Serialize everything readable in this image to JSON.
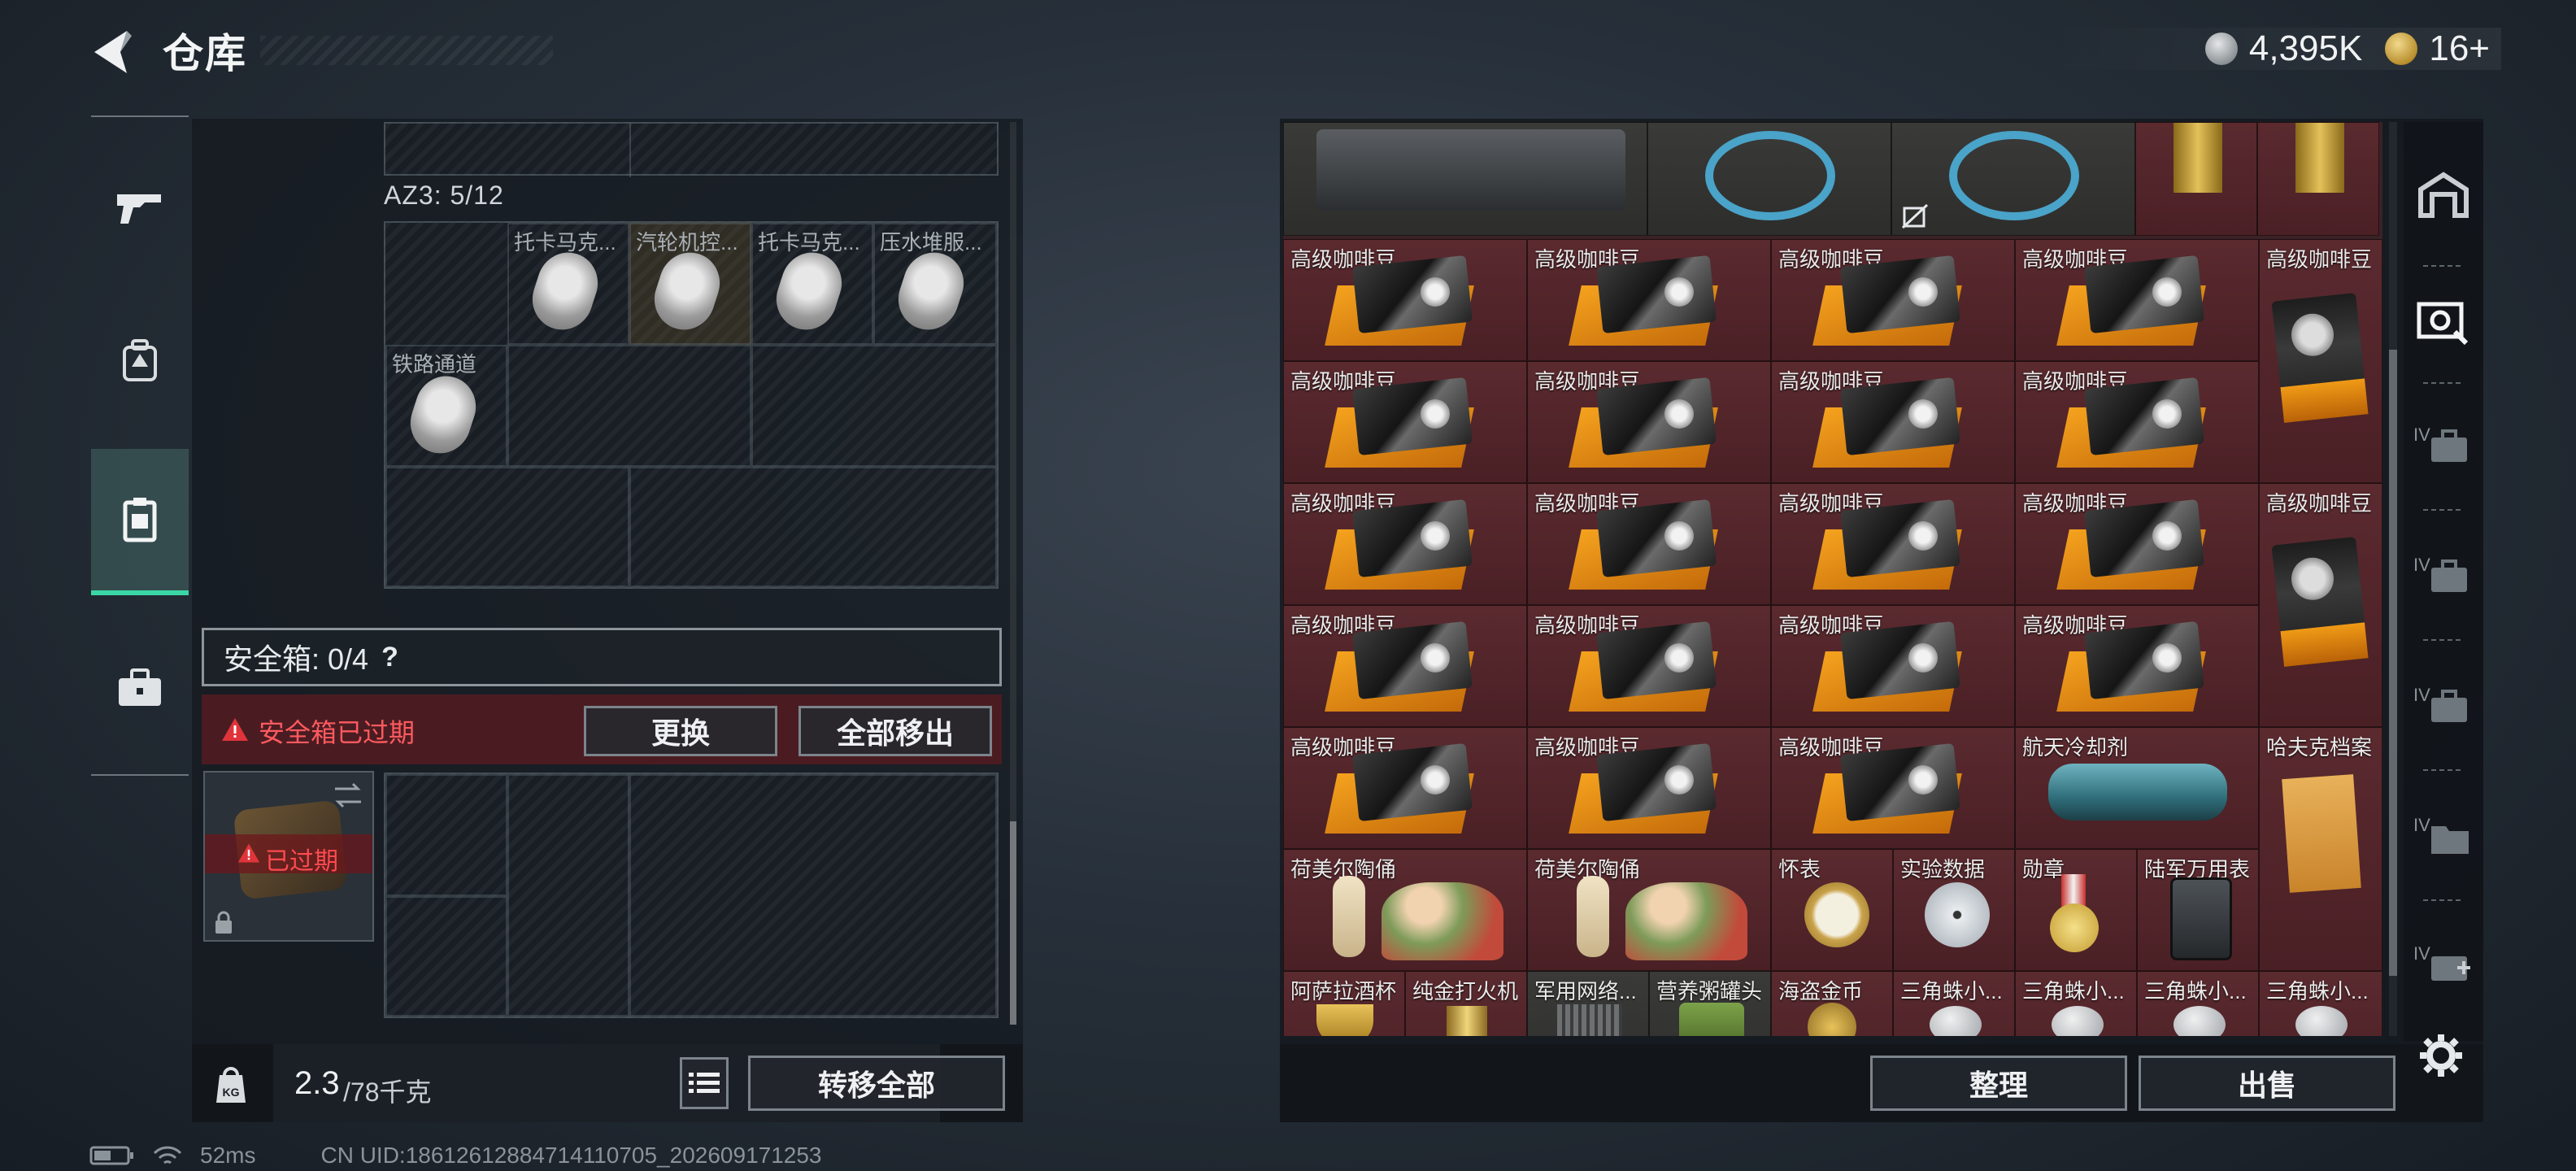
{
  "header": {
    "title": "仓库",
    "currency": [
      {
        "icon": "silver-coin-icon",
        "value": "4,395K"
      },
      {
        "icon": "gold-triangle-coin-icon",
        "value": "16+"
      }
    ]
  },
  "left_nav": {
    "items": [
      {
        "icon": "gun-icon",
        "active": false
      },
      {
        "icon": "backpack-icon",
        "active": false
      },
      {
        "icon": "container-icon",
        "active": true
      },
      {
        "icon": "briefcase-icon",
        "active": false
      }
    ]
  },
  "left_panel": {
    "az3_label": "AZ3: 5/12",
    "az3_items": [
      "托卡马克...",
      "汽轮机控...",
      "托卡马克...",
      "压水堆服...",
      "铁路通道"
    ],
    "safebox_label": "安全箱: 0/4",
    "safebox_help": "?",
    "expired_warning": "安全箱已过期",
    "replace_button": "更换",
    "move_all_out_button": "全部移出",
    "expired_badge": "已过期",
    "weight_value": "2.3",
    "weight_capacity": "/78千克",
    "transfer_all_button": "转移全部"
  },
  "right_panel": {
    "coffee_label": "高级咖啡豆",
    "items": {
      "coolant": "航天冷却剂",
      "hafuke_file": "哈夫克档案",
      "figurine": "荷美尔陶俑",
      "pocket_watch": "怀表",
      "lab_data": "实验数据",
      "medal": "勋章",
      "army_multimeter": "陆军万用表",
      "arabian_cup": "阿萨拉酒杯",
      "gold_lighter": "纯金打火机",
      "military_network": "军用网络...",
      "nutrition_can": "营养粥罐头",
      "pirate_coin": "海盗金币",
      "triangle_bird": "三角蛛小..."
    },
    "sort_button": "整理",
    "sell_button": "出售"
  },
  "right_nav": {
    "levels": [
      "IV",
      "IV",
      "IV",
      "IV",
      "IV"
    ]
  },
  "status_bar": {
    "ping": "52ms",
    "uid": "CN UID:18612612884714110705_202609171253"
  },
  "colors": {
    "accent": "#3bd6a6",
    "warning_red": "#e0343b",
    "item_red_bg": "#5a2a2f"
  }
}
